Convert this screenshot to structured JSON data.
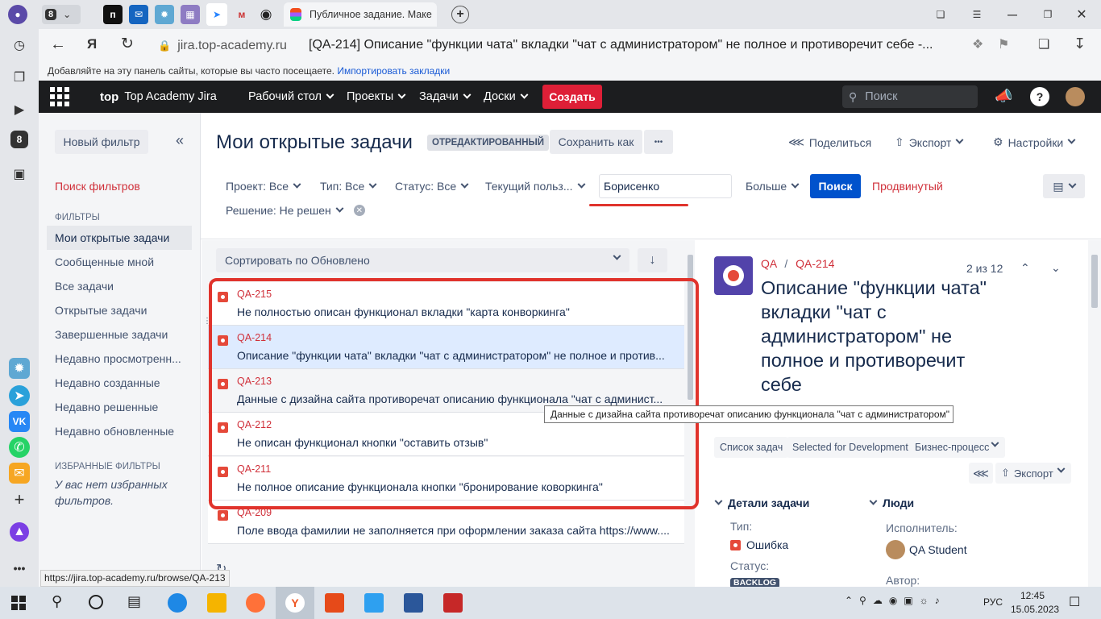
{
  "browser": {
    "tab_counter": "8",
    "active_tab_title": "Публичное задание. Маке",
    "url": "jira.top-academy.ru",
    "page_title": "[QA-214] Описание \"функции чата\" вкладки \"чат с администратором\" не полное и противоречит себе -...",
    "bookmarks_hint": "Добавляйте на эту панель сайты, которые вы часто посещаете.",
    "bookmarks_import": "Импортировать закладки",
    "sidebar_counter": "8",
    "status_url": "https://jira.top-academy.ru/browse/QA-213"
  },
  "jira_nav": {
    "logo": "top",
    "brand": "Top Academy Jira",
    "items": [
      "Рабочий стол",
      "Проекты",
      "Задачи",
      "Доски"
    ],
    "create": "Создать",
    "search_placeholder": "Поиск"
  },
  "filter_panel": {
    "new_filter": "Новый фильтр",
    "search_filters": "Поиск фильтров",
    "filters_heading": "ФИЛЬТРЫ",
    "items": [
      "Мои открытые задачи",
      "Сообщенные мной",
      "Все задачи",
      "Открытые задачи",
      "Завершенные задачи",
      "Недавно просмотренн...",
      "Недавно созданные",
      "Недавно решенные",
      "Недавно обновленные"
    ],
    "fav_heading": "ИЗБРАННЫЕ ФИЛЬТРЫ",
    "fav_empty": "У вас нет избранных фильтров."
  },
  "header": {
    "title": "Мои открытые задачи",
    "badge": "ОТРЕДАКТИРОВАННЫЙ",
    "save_as": "Сохранить как",
    "more": "•••",
    "share": "Поделиться",
    "export": "Экспорт",
    "settings": "Настройки"
  },
  "criteria": {
    "project": "Проект: Все",
    "type": "Тип: Все",
    "status": "Статус: Все",
    "current_user": "Текущий польз...",
    "text_value": "Борисенко",
    "more": "Больше",
    "search": "Поиск",
    "advanced": "Продвинутый",
    "resolution": "Решение: Не решен"
  },
  "list": {
    "sort_label": "Сортировать по Обновлено",
    "issues": [
      {
        "key": "QA-215",
        "summary": "Не полностью описан функционал вкладки \"карта конворкинга\""
      },
      {
        "key": "QA-214",
        "summary": "Описание \"функции чата\" вкладки \"чат с администратором\" не полное и против..."
      },
      {
        "key": "QA-213",
        "summary": "Данные с дизайна сайта противоречат описанию функционала \"чат с админист..."
      },
      {
        "key": "QA-212",
        "summary": "Не описан функционал кнопки \"оставить отзыв\""
      },
      {
        "key": "QA-211",
        "summary": "Не полное описание функционала кнопки \"бронирование коворкинга\""
      },
      {
        "key": "QA-209",
        "summary": "Поле ввода фамилии не заполняется при оформлении заказа сайта https://www...."
      }
    ],
    "tooltip": "Данные с дизайна сайта противоречат описанию функционала \"чат с администратором\""
  },
  "detail": {
    "project": "QA",
    "key": "QA-214",
    "position": "2 из 12",
    "title": "Описание \"функции чата\" вкладки \"чат с администратором\" не полное и противоречит себе",
    "buttons": [
      "Список задач",
      "Selected for Development",
      "Бизнес-процесс"
    ],
    "export": "Экспорт",
    "details_heading": "Детали задачи",
    "people_heading": "Люди",
    "type_label": "Тип:",
    "type_value": "Ошибка",
    "status_label": "Статус:",
    "status_value": "BACKLOG",
    "assignee_label": "Исполнитель:",
    "assignee_value": "QA Student",
    "author_label": "Автор:"
  },
  "taskbar": {
    "lang": "РУС",
    "time": "12:45",
    "date": "15.05.2023"
  },
  "colors": {
    "accent": "#0052cc",
    "create": "#de1f37",
    "highlight": "#e0332c"
  }
}
